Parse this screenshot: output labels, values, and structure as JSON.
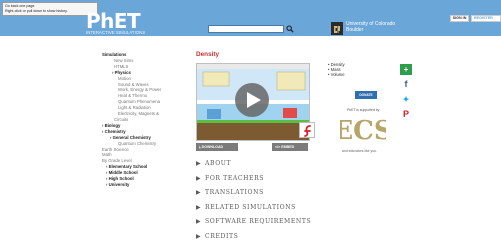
{
  "header": {
    "tooltip_line1": "Go back one page.",
    "tooltip_line2": "Right-click or pull down to show history.",
    "logo_text": "PhET",
    "logo_sub": "INTERACTIVE SIMULATIONS",
    "university_line1": "University of Colorado",
    "university_line2": "Boulder",
    "signin_label": "SIGN IN",
    "register_label": "REGISTER",
    "search_value": ""
  },
  "nav": [
    {
      "label": "Simulations",
      "kind": "h"
    },
    {
      "label": "New Sims",
      "kind": "indent1"
    },
    {
      "label": "HTML5",
      "kind": "indent1"
    },
    {
      "label": "› Physics",
      "kind": "bold"
    },
    {
      "label": "Motion",
      "kind": "indent2"
    },
    {
      "label": "Sound & Waves",
      "kind": "indent2"
    },
    {
      "label": "Work, Energy & Power",
      "kind": "indent2"
    },
    {
      "label": "Heat & Thermo",
      "kind": "indent2"
    },
    {
      "label": "Quantum Phenomena",
      "kind": "indent2"
    },
    {
      "label": "Light & Radiation",
      "kind": "indent2"
    },
    {
      "label": "Electricity, Magnets &",
      "kind": "indent2"
    },
    {
      "label": "Circuits",
      "kind": "indent1"
    },
    {
      "label": "› Biology",
      "kind": "bold0"
    },
    {
      "label": "› Chemistry",
      "kind": "bold0"
    },
    {
      "label": "› General Chemistry",
      "kind": "boldsub"
    },
    {
      "label": "Quantum Chemistry",
      "kind": "indent2"
    },
    {
      "label": "Earth Science",
      "kind": "indent0"
    },
    {
      "label": "Math",
      "kind": "indent0"
    },
    {
      "label": "By Grade Level",
      "kind": "indent0"
    },
    {
      "label": "› Elementary School",
      "kind": "boldsub2"
    },
    {
      "label": "› Middle School",
      "kind": "boldsub2"
    },
    {
      "label": "› High School",
      "kind": "boldsub2"
    },
    {
      "label": "› University",
      "kind": "boldsub2"
    }
  ],
  "main": {
    "title": "Density",
    "download_label": "DOWNLOAD",
    "embed_label": "EMBED",
    "topics": [
      "Density",
      "Mass",
      "Volume"
    ],
    "donate_label": "DONATE",
    "supported_by": "PhET is supported by",
    "sponsor": "ECS",
    "educators_line": "and educators like you."
  },
  "sections": [
    "ABOUT",
    "FOR TEACHERS",
    "TRANSLATIONS",
    "RELATED SIMULATIONS",
    "SOFTWARE REQUIREMENTS",
    "CREDITS"
  ],
  "colors": {
    "header_bg": "#6ba6d8",
    "title_red": "#d03131",
    "button_gray": "#7b7b7b",
    "donate_blue": "#2f6fb0"
  },
  "icons": [
    "search-icon",
    "play-icon",
    "download-icon",
    "embed-icon",
    "flash-icon",
    "plus-share-icon",
    "facebook-icon",
    "twitter-icon",
    "pinterest-icon"
  ]
}
